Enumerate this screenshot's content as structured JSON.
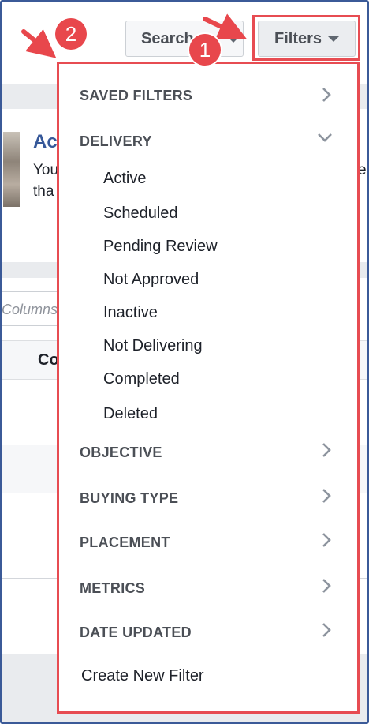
{
  "toolbar": {
    "search_label": "Search",
    "filters_label": "Filters"
  },
  "background": {
    "ad_title": "Ac",
    "ad_line1": "You",
    "ad_line2": "tha",
    "ad_line1_right": "e",
    "columns_placeholder": "Columns",
    "column_header": "Co"
  },
  "filters_menu": {
    "saved_filters": "SAVED FILTERS",
    "delivery": "DELIVERY",
    "delivery_options": [
      "Active",
      "Scheduled",
      "Pending Review",
      "Not Approved",
      "Inactive",
      "Not Delivering",
      "Completed",
      "Deleted"
    ],
    "objective": "OBJECTIVE",
    "buying_type": "BUYING TYPE",
    "placement": "PLACEMENT",
    "metrics": "METRICS",
    "date_updated": "DATE UPDATED",
    "create_new_filter": "Create New Filter"
  },
  "annotations": {
    "step_1": "1",
    "step_2": "2",
    "highlight_color": "#e74c52",
    "badge_color": "#e8474c"
  },
  "icons": {
    "chevron_right": "chevron-right-icon",
    "chevron_down": "chevron-down-icon",
    "caret_down": "caret-down-icon"
  }
}
